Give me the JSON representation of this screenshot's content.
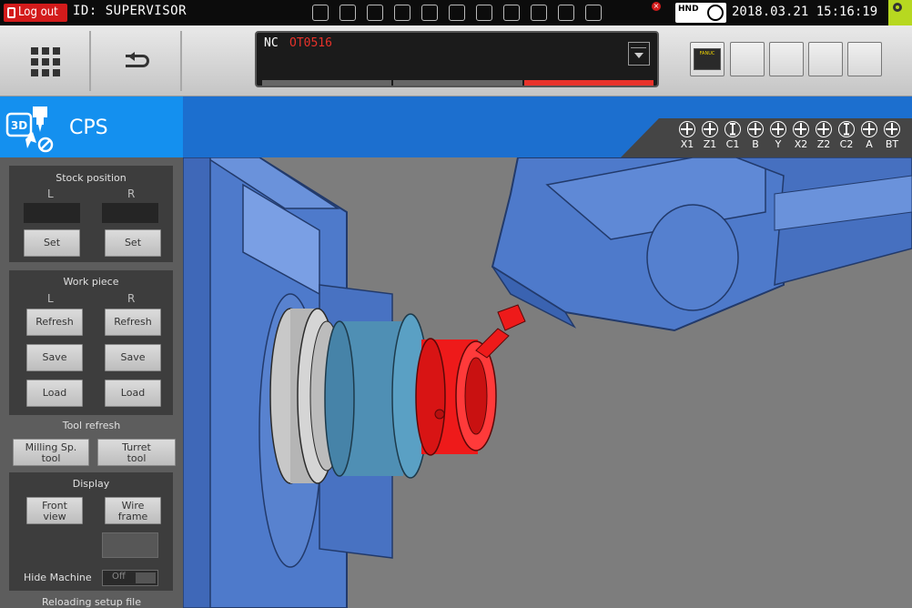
{
  "statusbar": {
    "logout_label": "Log out",
    "user_id": "ID: SUPERVISOR",
    "mode_badge": "HND",
    "datetime": "2018.03.21 15:16:19",
    "status_icons": [
      "cycle-icon",
      "feed-hold-icon",
      "single-block-icon",
      "block-skip-icon",
      "dry-run-icon",
      "program-lock-icon",
      "machine-lock-icon",
      "optional-stop-icon",
      "spindle-icon",
      "coolant-icon",
      "tool-icon"
    ]
  },
  "nc": {
    "label": "NC",
    "program": "OT0516",
    "segment_colors": [
      "#666666",
      "#666666",
      "#e8322a"
    ]
  },
  "toolbar": {
    "squares": [
      "fanuc-button",
      "screen-button-1",
      "screen-button-2",
      "screen-button-3",
      "screen-button-4"
    ],
    "fanuc_text": "FANUC"
  },
  "cps": {
    "title": "CPS",
    "logo_text": "3D"
  },
  "axes": [
    {
      "label": "X1",
      "glyph": "plus"
    },
    {
      "label": "Z1",
      "glyph": "plus"
    },
    {
      "label": "C1",
      "glyph": "bar"
    },
    {
      "label": "B",
      "glyph": "plus"
    },
    {
      "label": "Y",
      "glyph": "plus"
    },
    {
      "label": "X2",
      "glyph": "plus"
    },
    {
      "label": "Z2",
      "glyph": "plus"
    },
    {
      "label": "C2",
      "glyph": "bar"
    },
    {
      "label": "A",
      "glyph": "plus"
    },
    {
      "label": "BT",
      "glyph": "plus"
    }
  ],
  "sidebar": {
    "stock_position": {
      "title": "Stock position",
      "left": "L",
      "right": "R",
      "set_label": "Set"
    },
    "work_piece": {
      "title": "Work piece",
      "left": "L",
      "right": "R",
      "refresh_label": "Refresh",
      "save_label": "Save",
      "load_label": "Load"
    },
    "tool_refresh": {
      "title": "Tool refresh",
      "milling_label_1": "Milling Sp.",
      "milling_label_2": "tool",
      "turret_label_1": "Turret",
      "turret_label_2": "tool"
    },
    "display": {
      "title": "Display",
      "front_label_1": "Front",
      "front_label_2": "view",
      "wire_label_1": "Wire",
      "wire_label_2": "frame",
      "hide_machine_label": "Hide Machine",
      "hide_machine_state": "Off"
    },
    "reloading_title": "Reloading setup file"
  },
  "colors": {
    "accent_blue": "#1490ef",
    "header_blue": "#1c6fcf",
    "alarm_red": "#e8322a",
    "machine_blue": "#4d79c7",
    "workpiece_red": "#ee1a1a",
    "chuck_teal": "#4f8fb4"
  }
}
